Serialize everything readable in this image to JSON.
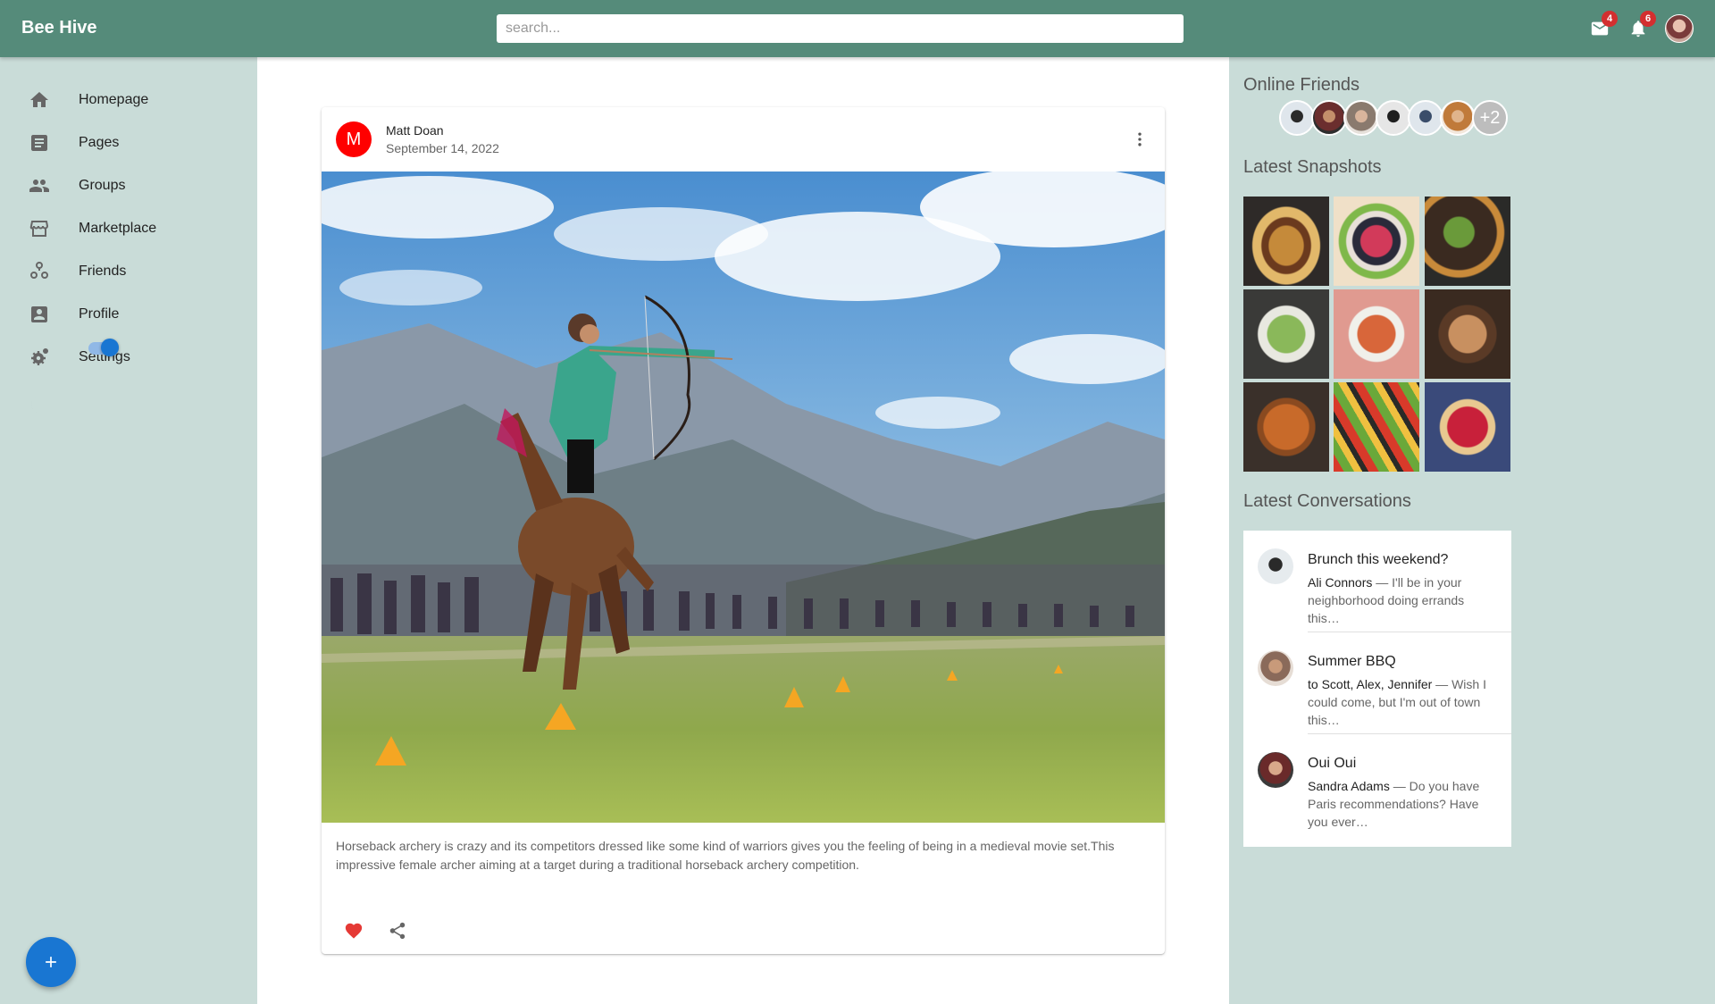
{
  "app": {
    "title": "Bee Hive"
  },
  "search": {
    "placeholder": "search..."
  },
  "topbar": {
    "mail_count": "4",
    "notifications_count": "6"
  },
  "sidebar": {
    "items": [
      {
        "label": "Homepage",
        "icon": "home-icon"
      },
      {
        "label": "Pages",
        "icon": "article-icon"
      },
      {
        "label": "Groups",
        "icon": "group-icon"
      },
      {
        "label": "Marketplace",
        "icon": "storefront-icon"
      },
      {
        "label": "Friends",
        "icon": "diversity-icon"
      },
      {
        "label": "Profile",
        "icon": "account-box-icon"
      },
      {
        "label": "Settings",
        "icon": "settings-applications-icon"
      }
    ],
    "dark_mode_on": true
  },
  "post": {
    "avatar_letter": "M",
    "author": "Matt Doan",
    "date": "September 14, 2022",
    "caption": "Horseback archery is crazy and its competitors dressed like some kind of warriors gives you the feeling of being in a medieval movie set.This impressive female archer aiming at a target during a traditional horseback archery competition.",
    "liked": true
  },
  "right": {
    "online_friends_title": "Online Friends",
    "online_more": "+2",
    "snapshots_title": "Latest Snapshots",
    "conversations_title": "Latest Conversations",
    "conversations": [
      {
        "title": "Brunch this weekend?",
        "who": "Ali Connors",
        "text": " — I'll be in your neighborhood doing errands this…"
      },
      {
        "title": "Summer BBQ",
        "who": "to Scott, Alex, Jennifer",
        "text": " — Wish I could come, but I'm out of town this…"
      },
      {
        "title": "Oui Oui",
        "who": "Sandra Adams",
        "text": " — Do you have Paris recommendations? Have you ever…"
      }
    ]
  },
  "colors": {
    "appbar": "#558b7a",
    "background": "#c9dcd8",
    "accent": "#1976d2",
    "badge": "#d32f2f",
    "like": "#e53935"
  }
}
